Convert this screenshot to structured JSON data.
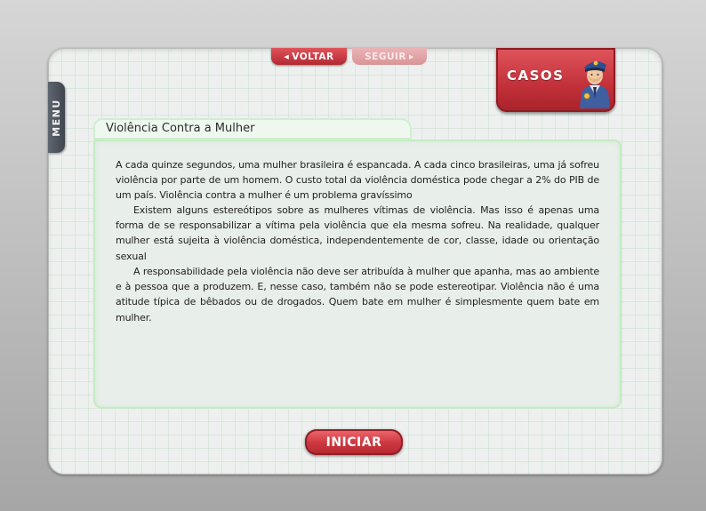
{
  "menu": {
    "label": "MENU"
  },
  "nav": {
    "back_label": "VOLTAR",
    "next_label": "SEGUIR"
  },
  "casos": {
    "label": "CASOS",
    "icon": "police-officer-icon"
  },
  "article": {
    "title": "Violência Contra a Mulher",
    "paragraphs": [
      "A cada quinze segundos, uma mulher brasileira é espancada. A cada cinco brasileiras, uma já sofreu violência por parte de um homem. O custo total da violência doméstica pode chegar a 2% do PIB de um país. Violência contra a mulher é um problema gravíssimo",
      "Existem alguns estereótipos sobre as mulheres vítimas de violência. Mas isso é apenas uma forma de se responsabilizar a vítima pela violência que ela mesma sofreu. Na realidade, qualquer mulher está sujeita à violência doméstica, independentemente de cor, classe, idade ou orientação sexual",
      "A responsabilidade pela violência não deve ser atribuída à mulher que apanha, mas ao ambiente e à pessoa que a produzem. E, nesse caso, também não se pode estereotipar. Violência não é uma atitude típica de bêbados ou de drogados. Quem bate em mulher é simplesmente quem bate em mulher."
    ]
  },
  "start": {
    "label": "INICIAR"
  },
  "colors": {
    "accent_red": "#c23039",
    "panel_bg": "#edf0ee",
    "content_border_green": "#c3ecc3",
    "menu_tab": "#4b525c"
  }
}
